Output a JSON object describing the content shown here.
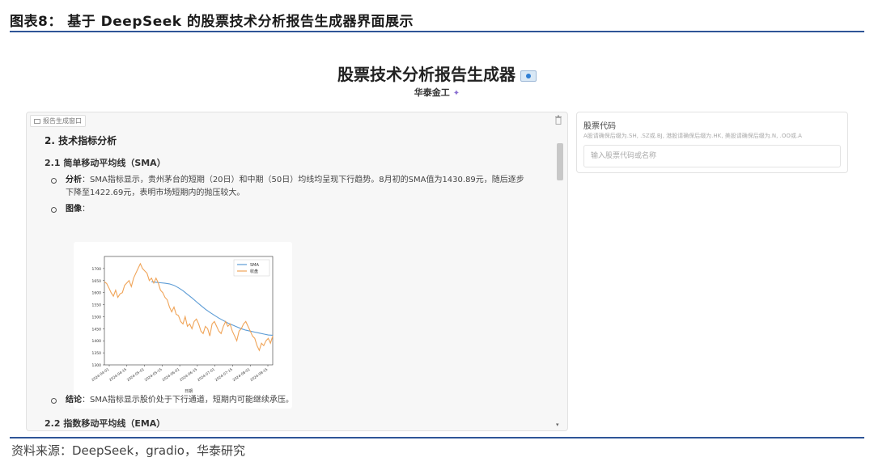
{
  "figure": {
    "title": "图表8： 基于 DeepSeek 的股票技术分析报告生成器界面展示",
    "source": "资料来源：DeepSeek，gradio，华泰研究"
  },
  "app": {
    "title": "股票技术分析报告生成器",
    "subtitle": "华泰金工"
  },
  "report_panel": {
    "label": "报告生成窗口",
    "section_title": "2. 技术指标分析",
    "sub1_title": "2.1 简单移动平均线（SMA）",
    "analysis_label": "分析",
    "analysis_text": "：SMA指标显示，贵州茅台的短期（20日）和中期（50日）均线均呈现下行趋势。8月初的SMA值为1430.89元，随后逐步下降至1422.69元，表明市场短期内的抛压较大。",
    "image_label": "图像",
    "image_colon": "：",
    "conclusion_label": "结论",
    "conclusion_text": "：SMA指标显示股价处于下行通道，短期内可能继续承压。",
    "sub2_title": "2.2 指数移动平均线（EMA）"
  },
  "stock_input": {
    "label": "股票代码",
    "hint": "A股请确保后缀为.SH, .SZ或.BJ, 港股请确保后缀为.HK, 美股请确保后缀为.N, .OO或.A",
    "placeholder": "输入股票代码或名称",
    "value": ""
  },
  "colors": {
    "rule": "#2f5597",
    "sma": "#5b9bd5",
    "price": "#f0a458"
  },
  "chart_data": {
    "type": "line",
    "xlabel": "日期",
    "ylabel": "",
    "ylim": [
      1300,
      1750
    ],
    "yticks": [
      1300,
      1350,
      1400,
      1450,
      1500,
      1550,
      1600,
      1650,
      1700
    ],
    "xticks": [
      "2024-04-01",
      "2024-04-15",
      "2024-05-01",
      "2024-05-15",
      "2024-06-01",
      "2024-06-15",
      "2024-07-01",
      "2024-07-15",
      "2024-08-01",
      "2024-08-15"
    ],
    "legend_position": "top-right",
    "series": [
      {
        "name": "SMA",
        "color": "#5b9bd5",
        "points": [
          [
            21,
            1645
          ],
          [
            23,
            1643
          ],
          [
            25,
            1641
          ],
          [
            27,
            1639
          ],
          [
            29,
            1636
          ],
          [
            31,
            1630
          ],
          [
            33,
            1620
          ],
          [
            35,
            1608
          ],
          [
            37,
            1593
          ],
          [
            39,
            1578
          ],
          [
            41,
            1562
          ],
          [
            43,
            1546
          ],
          [
            45,
            1531
          ],
          [
            47,
            1518
          ],
          [
            49,
            1506
          ],
          [
            51,
            1494
          ],
          [
            53,
            1484
          ],
          [
            55,
            1474
          ],
          [
            57,
            1466
          ],
          [
            59,
            1458
          ],
          [
            61,
            1450
          ],
          [
            63,
            1444
          ],
          [
            65,
            1440
          ],
          [
            67,
            1436
          ],
          [
            69,
            1432
          ],
          [
            71,
            1428
          ],
          [
            73,
            1424
          ],
          [
            75,
            1423
          ]
        ]
      },
      {
        "name": "收盘",
        "color": "#f0a458",
        "points": [
          [
            0,
            1645
          ],
          [
            1,
            1638
          ],
          [
            2,
            1620
          ],
          [
            3,
            1600
          ],
          [
            4,
            1585
          ],
          [
            5,
            1610
          ],
          [
            6,
            1580
          ],
          [
            7,
            1595
          ],
          [
            8,
            1600
          ],
          [
            9,
            1630
          ],
          [
            10,
            1640
          ],
          [
            11,
            1650
          ],
          [
            12,
            1625
          ],
          [
            13,
            1660
          ],
          [
            14,
            1680
          ],
          [
            15,
            1700
          ],
          [
            16,
            1720
          ],
          [
            17,
            1700
          ],
          [
            18,
            1690
          ],
          [
            19,
            1680
          ],
          [
            20,
            1650
          ],
          [
            21,
            1660
          ],
          [
            22,
            1640
          ],
          [
            23,
            1660
          ],
          [
            24,
            1640
          ],
          [
            25,
            1610
          ],
          [
            26,
            1600
          ],
          [
            27,
            1580
          ],
          [
            28,
            1570
          ],
          [
            29,
            1540
          ],
          [
            30,
            1520
          ],
          [
            31,
            1540
          ],
          [
            32,
            1510
          ],
          [
            33,
            1505
          ],
          [
            34,
            1480
          ],
          [
            35,
            1470
          ],
          [
            36,
            1500
          ],
          [
            37,
            1460
          ],
          [
            38,
            1470
          ],
          [
            39,
            1450
          ],
          [
            40,
            1480
          ],
          [
            41,
            1490
          ],
          [
            42,
            1470
          ],
          [
            43,
            1440
          ],
          [
            44,
            1430
          ],
          [
            45,
            1460
          ],
          [
            46,
            1450
          ],
          [
            47,
            1420
          ],
          [
            48,
            1470
          ],
          [
            49,
            1480
          ],
          [
            50,
            1460
          ],
          [
            51,
            1440
          ],
          [
            52,
            1430
          ],
          [
            53,
            1460
          ],
          [
            54,
            1480
          ],
          [
            55,
            1460
          ],
          [
            56,
            1470
          ],
          [
            57,
            1440
          ],
          [
            58,
            1420
          ],
          [
            59,
            1400
          ],
          [
            60,
            1440
          ],
          [
            61,
            1450
          ],
          [
            62,
            1470
          ],
          [
            63,
            1480
          ],
          [
            64,
            1460
          ],
          [
            65,
            1440
          ],
          [
            66,
            1420
          ],
          [
            67,
            1410
          ],
          [
            68,
            1380
          ],
          [
            69,
            1360
          ],
          [
            70,
            1390
          ],
          [
            71,
            1380
          ],
          [
            72,
            1400
          ],
          [
            73,
            1410
          ],
          [
            74,
            1390
          ],
          [
            75,
            1420
          ]
        ]
      }
    ]
  }
}
